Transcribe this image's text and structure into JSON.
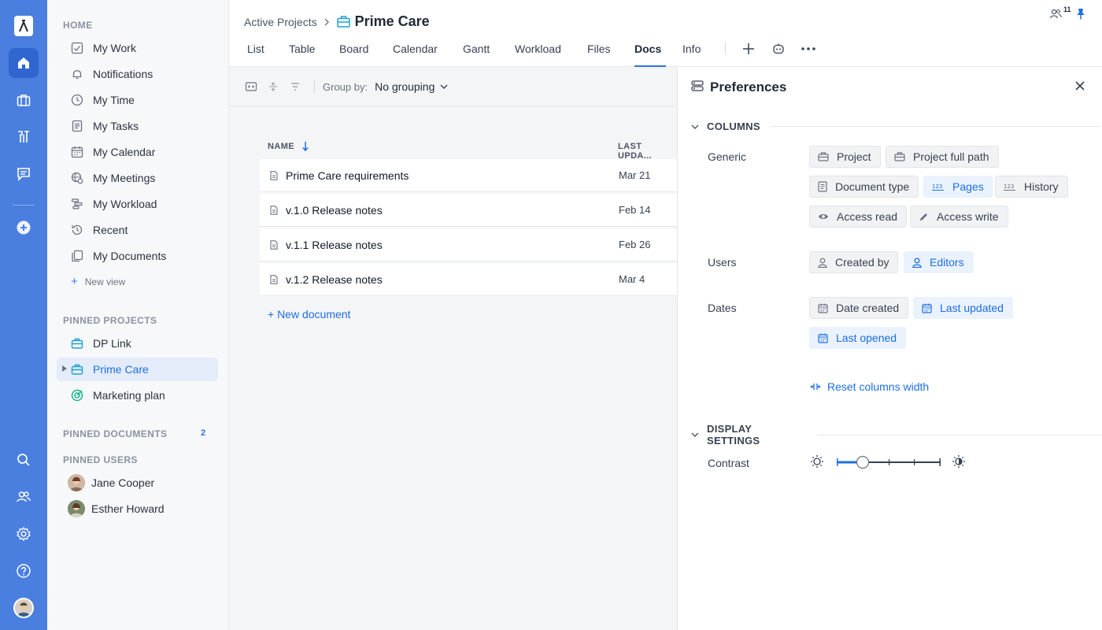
{
  "rail": {
    "items": [
      "logo-icon",
      "home-icon",
      "briefcase-icon",
      "tools-icon",
      "chat-icon",
      "add-icon",
      "search-icon",
      "people-icon",
      "gear-icon",
      "help-icon"
    ]
  },
  "sidebar": {
    "home_title": "HOME",
    "items": [
      {
        "label": "My Work",
        "icon": "mywork-icon"
      },
      {
        "label": "Notifications",
        "icon": "bell-icon"
      },
      {
        "label": "My Time",
        "icon": "clock-icon"
      },
      {
        "label": "My Tasks",
        "icon": "tasks-icon"
      },
      {
        "label": "My Calendar",
        "icon": "calendar-icon"
      },
      {
        "label": "My Meetings",
        "icon": "meetings-icon"
      },
      {
        "label": "My Workload",
        "icon": "workload-icon"
      },
      {
        "label": "Recent",
        "icon": "history-icon"
      },
      {
        "label": "My Documents",
        "icon": "documents-icon"
      }
    ],
    "new_view": "New view",
    "pinned_projects_title": "PINNED PROJECTS",
    "projects": [
      {
        "label": "DP Link"
      },
      {
        "label": "Prime Care"
      },
      {
        "label": "Marketing plan"
      }
    ],
    "pinned_documents_title": "PINNED DOCUMENTS",
    "pinned_documents_count": "2",
    "pinned_users_title": "PINNED USERS",
    "users": [
      {
        "label": "Jane Cooper"
      },
      {
        "label": "Esther Howard"
      }
    ]
  },
  "header": {
    "breadcrumb_parent": "Active Projects",
    "project_name": "Prime Care",
    "tabs": [
      "List",
      "Table",
      "Board",
      "Calendar",
      "Gantt",
      "Workload",
      "Files",
      "Docs",
      "Info"
    ],
    "active_tab": "Docs",
    "members_count": "11"
  },
  "toolbar": {
    "group_by_label": "Group by:",
    "group_by_value": "No grouping"
  },
  "docs_table": {
    "columns": [
      "NAME",
      "LAST UPDA..."
    ],
    "rows": [
      {
        "name": "Prime Care requirements",
        "date": "Mar 21"
      },
      {
        "name": "v.1.0 Release notes",
        "date": "Feb 14"
      },
      {
        "name": "v.1.1 Release notes",
        "date": "Feb 26"
      },
      {
        "name": "v.1.2 Release notes",
        "date": "Mar 4"
      }
    ],
    "new_document": "+ New document"
  },
  "preferences": {
    "title": "Preferences",
    "columns_title": "COLUMNS",
    "generic_label": "Generic",
    "generic_chips": [
      {
        "label": "Project",
        "on": false
      },
      {
        "label": "Project full path",
        "on": false
      },
      {
        "label": "Document type",
        "on": false
      },
      {
        "label": "Pages",
        "on": true
      },
      {
        "label": "History",
        "on": false
      },
      {
        "label": "Access read",
        "on": false
      },
      {
        "label": "Access write",
        "on": false
      }
    ],
    "users_label": "Users",
    "users_chips": [
      {
        "label": "Created by",
        "on": false
      },
      {
        "label": "Editors",
        "on": true
      }
    ],
    "dates_label": "Dates",
    "dates_chips": [
      {
        "label": "Date created",
        "on": false
      },
      {
        "label": "Last updated",
        "on": true
      },
      {
        "label": "Last opened",
        "on": true
      }
    ],
    "reset_label": "Reset columns width",
    "display_title": "DISPLAY SETTINGS",
    "contrast_label": "Contrast",
    "contrast_level": 0.25
  },
  "colors": {
    "rail": "#4a7fe0",
    "accent": "#1c6fe3",
    "chip_on_bg": "#eaf2fd"
  }
}
